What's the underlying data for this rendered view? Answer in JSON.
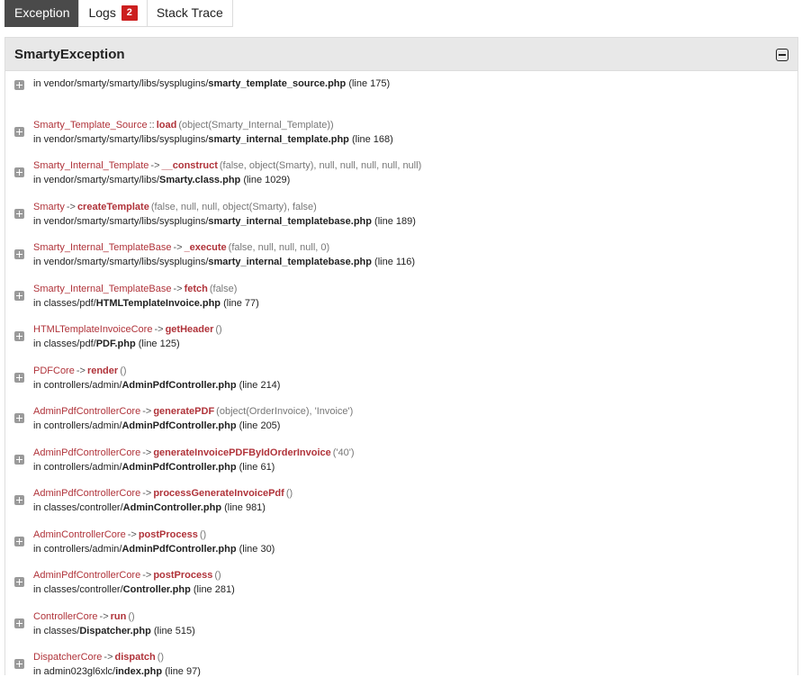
{
  "tabs": [
    {
      "label": "Exception",
      "active": true
    },
    {
      "label": "Logs",
      "badge": "2",
      "active": false
    },
    {
      "label": "Stack Trace",
      "active": false
    }
  ],
  "panel": {
    "title": "SmartyException"
  },
  "colors": {
    "accent": "#b0333a",
    "badge": "#cc1f1f",
    "active_tab": "#4a4a4a"
  },
  "frames": [
    {
      "call": null,
      "path_prefix": "in vendor/smarty/smarty/libs/sysplugins/",
      "file": "smarty_template_source.php",
      "line": "(line 175)"
    },
    {
      "class": "Smarty_Template_Source",
      "op": "::",
      "fn": "load",
      "args": "(object(Smarty_Internal_Template))",
      "path_prefix": "in vendor/smarty/smarty/libs/sysplugins/",
      "file": "smarty_internal_template.php",
      "line": "(line 168)"
    },
    {
      "class": "Smarty_Internal_Template",
      "op": "->",
      "fn": "__construct",
      "args": "(false, object(Smarty), null, null, null, null, null)",
      "path_prefix": "in vendor/smarty/smarty/libs/",
      "file": "Smarty.class.php",
      "line": "(line 1029)"
    },
    {
      "class": "Smarty",
      "op": "->",
      "fn": "createTemplate",
      "args": "(false, null, null, object(Smarty), false)",
      "path_prefix": "in vendor/smarty/smarty/libs/sysplugins/",
      "file": "smarty_internal_templatebase.php",
      "line": "(line 189)"
    },
    {
      "class": "Smarty_Internal_TemplateBase",
      "op": "->",
      "fn": "_execute",
      "args": "(false, null, null, null, 0)",
      "path_prefix": "in vendor/smarty/smarty/libs/sysplugins/",
      "file": "smarty_internal_templatebase.php",
      "line": "(line 116)"
    },
    {
      "class": "Smarty_Internal_TemplateBase",
      "op": "->",
      "fn": "fetch",
      "args": "(false)",
      "path_prefix": "in classes/pdf/",
      "file": "HTMLTemplateInvoice.php",
      "line": "(line 77)"
    },
    {
      "class": "HTMLTemplateInvoiceCore",
      "op": "->",
      "fn": "getHeader",
      "args": "()",
      "path_prefix": "in classes/pdf/",
      "file": "PDF.php",
      "line": "(line 125)"
    },
    {
      "class": "PDFCore",
      "op": "->",
      "fn": "render",
      "args": "()",
      "path_prefix": "in controllers/admin/",
      "file": "AdminPdfController.php",
      "line": "(line 214)"
    },
    {
      "class": "AdminPdfControllerCore",
      "op": "->",
      "fn": "generatePDF",
      "args": "(object(OrderInvoice), 'Invoice')",
      "path_prefix": "in controllers/admin/",
      "file": "AdminPdfController.php",
      "line": "(line 205)"
    },
    {
      "class": "AdminPdfControllerCore",
      "op": "->",
      "fn": "generateInvoicePDFByIdOrderInvoice",
      "args": "('40')",
      "path_prefix": "in controllers/admin/",
      "file": "AdminPdfController.php",
      "line": "(line 61)"
    },
    {
      "class": "AdminPdfControllerCore",
      "op": "->",
      "fn": "processGenerateInvoicePdf",
      "args": "()",
      "path_prefix": "in classes/controller/",
      "file": "AdminController.php",
      "line": "(line 981)"
    },
    {
      "class": "AdminControllerCore",
      "op": "->",
      "fn": "postProcess",
      "args": "()",
      "path_prefix": "in controllers/admin/",
      "file": "AdminPdfController.php",
      "line": "(line 30)"
    },
    {
      "class": "AdminPdfControllerCore",
      "op": "->",
      "fn": "postProcess",
      "args": "()",
      "path_prefix": "in classes/controller/",
      "file": "Controller.php",
      "line": "(line 281)"
    },
    {
      "class": "ControllerCore",
      "op": "->",
      "fn": "run",
      "args": "()",
      "path_prefix": "in classes/",
      "file": "Dispatcher.php",
      "line": "(line 515)"
    },
    {
      "class": "DispatcherCore",
      "op": "->",
      "fn": "dispatch",
      "args": "()",
      "path_prefix": "in admin023gl6xlc/",
      "file": "index.php",
      "line": "(line 97)"
    }
  ]
}
